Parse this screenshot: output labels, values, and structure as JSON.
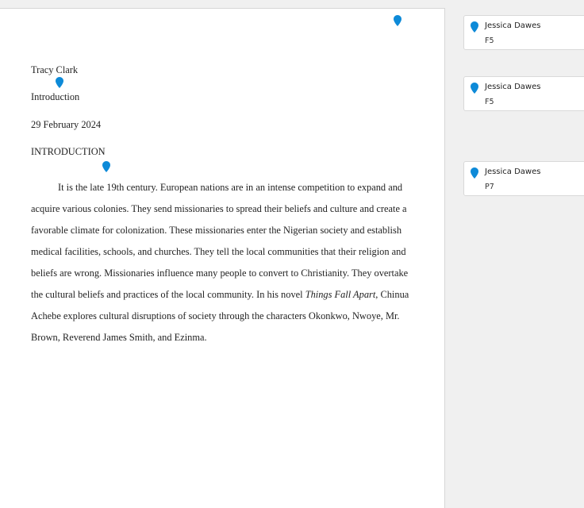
{
  "colors": {
    "pin": "#0d8ad8",
    "canvas": "#f0f0f0",
    "page": "#ffffff"
  },
  "document": {
    "author": "Tracy Clark",
    "assignment": "Introduction",
    "date": "29 February 2024",
    "heading": "INTRODUCTION",
    "paragraph_lines": [
      "It is the late 19th century. European nations are in an intense competition to expand and",
      "acquire various colonies. They send missionaries to spread their beliefs and culture and create a",
      "favorable climate for colonization. These missionaries enter the Nigerian society and establish",
      "medical facilities, schools, and churches. They tell the local communities that their religion and",
      "beliefs are wrong. Missionaries influence many people to convert to Christianity.  They overtake"
    ],
    "line6_before": "the cultural beliefs and practices of the local community. In his novel ",
    "line6_italic": "Things Fall Apart",
    "line6_after": ", Chinua",
    "paragraph_lines_end": [
      "Achebe explores cultural disruptions of society through the characters Okonkwo, Nwoye, Mr.",
      "Brown, Reverend James Smith, and Ezinma."
    ]
  },
  "comment_markers": [
    {
      "icon": "comment-pin-icon"
    },
    {
      "icon": "comment-pin-icon"
    },
    {
      "icon": "comment-pin-icon"
    }
  ],
  "comments": [
    {
      "author": "Jessica Dawes",
      "code": "F5"
    },
    {
      "author": "Jessica Dawes",
      "code": "F5"
    },
    {
      "author": "Jessica Dawes",
      "code": "P7"
    }
  ]
}
